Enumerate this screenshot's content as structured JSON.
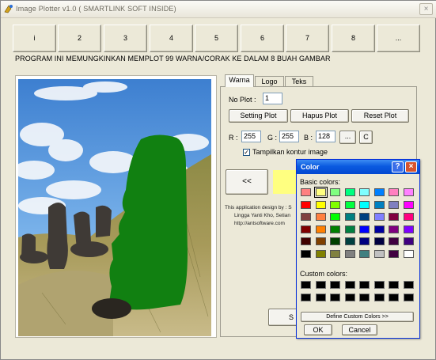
{
  "window": {
    "title": "Image Plotter v1.0 ( SMARTLINK SOFT INSIDE)",
    "close_glyph": "×"
  },
  "image_tabs": [
    "i",
    "2",
    "3",
    "4",
    "5",
    "6",
    "7",
    "8",
    "..."
  ],
  "info_text": "PROGRAM INI MEMUNGKINKAN MEMPLOT 99 WARNA/CORAK KE DALAM 8 BUAH GAMBAR",
  "panel": {
    "tabs": [
      "Warna",
      "Logo",
      "Teks"
    ],
    "no_plot_label": "No Plot :",
    "no_plot_value": "1",
    "setting_plot": "Setting Plot",
    "hapus_plot": "Hapus Plot",
    "reset_plot": "Reset Plot",
    "r_label": "R :",
    "r_value": "255",
    "g_label": "G :",
    "g_value": "255",
    "b_label": "B :",
    "b_value": "128",
    "ellipsis_btn": "...",
    "c_btn": "C",
    "show_contour_label": "Tampilkan kontur image",
    "show_contour_checked": "✓",
    "prev_btn": "<<",
    "swatch_color": "#ffff80",
    "credits": [
      "This application design by : S",
      "Lingga Yanti Kho, Setian",
      "http://antsoftware.com"
    ],
    "bottom_btn_partial": "S"
  },
  "color_dialog": {
    "title": "Color",
    "help_glyph": "?",
    "close_glyph": "×",
    "basic_label": "Basic colors:",
    "basic_colors": [
      "#ff8080",
      "#ffff80",
      "#80ff80",
      "#00ff80",
      "#80ffff",
      "#0080ff",
      "#ff80c0",
      "#ff80ff",
      "#ff0000",
      "#ffff00",
      "#80ff00",
      "#00ff40",
      "#00ffff",
      "#0080c0",
      "#8080c0",
      "#ff00ff",
      "#804040",
      "#ff8040",
      "#00ff00",
      "#008080",
      "#004080",
      "#8080ff",
      "#800040",
      "#ff0080",
      "#800000",
      "#ff8000",
      "#008000",
      "#008040",
      "#0000ff",
      "#0000a0",
      "#800080",
      "#8000ff",
      "#400000",
      "#804000",
      "#004000",
      "#004040",
      "#000080",
      "#000040",
      "#400040",
      "#400080",
      "#000000",
      "#808000",
      "#808040",
      "#808080",
      "#408080",
      "#c0c0c0",
      "#400040",
      "#ffffff"
    ],
    "selected_index": 1,
    "custom_label": "Custom colors:",
    "define_btn": "Define Custom Colors >>",
    "ok_btn": "OK",
    "cancel_btn": "Cancel"
  }
}
